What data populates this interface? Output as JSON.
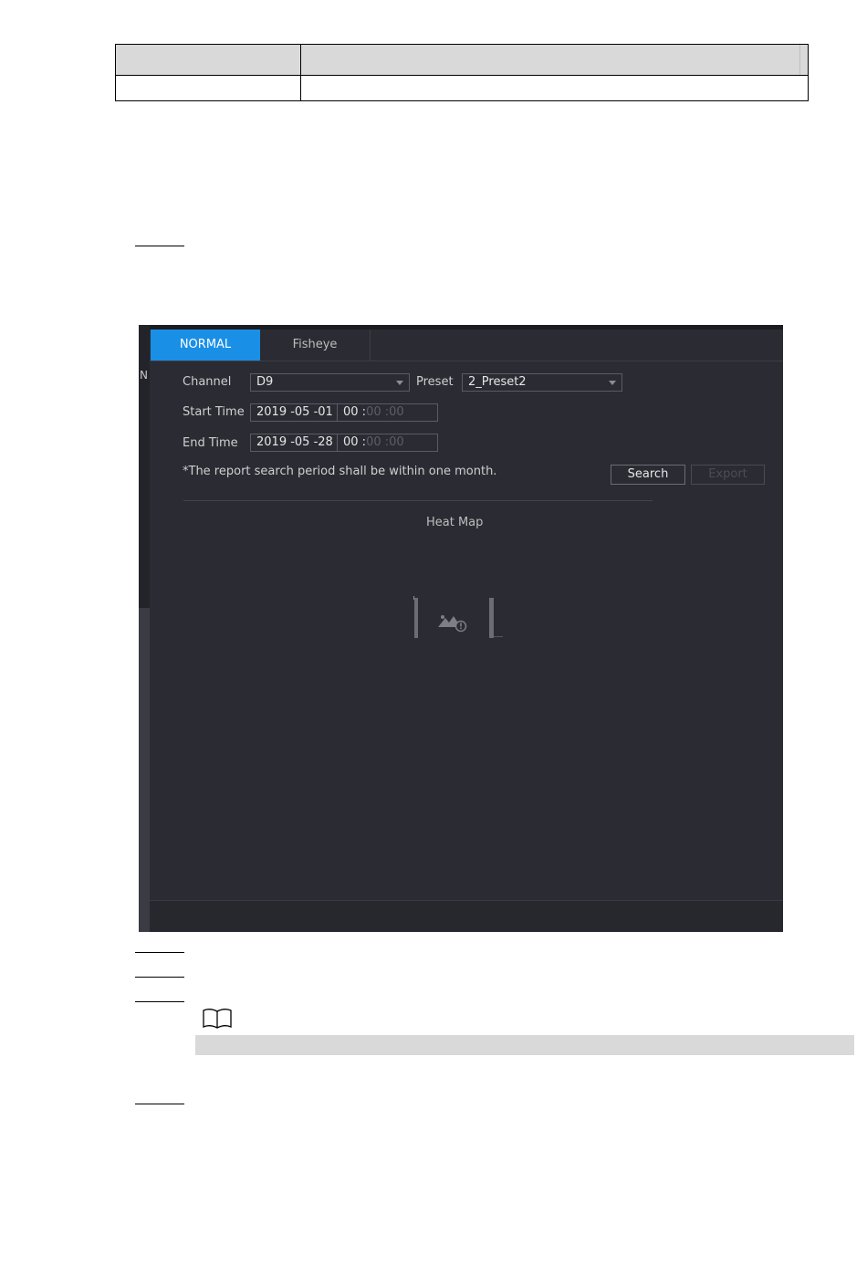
{
  "app": {
    "tabs": [
      {
        "label": "NORMAL",
        "active": true
      },
      {
        "label": "Fisheye",
        "active": false
      }
    ],
    "left_strip_letter": "N",
    "form": {
      "channel_label": "Channel",
      "channel_value": "D9",
      "preset_label": "Preset",
      "preset_value": "2_Preset2",
      "start_time_label": "Start Time",
      "start_date": "2019 -05 -01",
      "start_hour": "00 :",
      "start_min": "00 :",
      "start_sec": "00",
      "end_time_label": "End Time",
      "end_date": "2019 -05 -28",
      "end_hour": "00 :",
      "end_min": "00 :",
      "end_sec": "00",
      "notice": "*The report search period shall be within one month.",
      "search_button": "Search",
      "export_button": "Export"
    },
    "heatmap": {
      "title": "Heat Map",
      "placeholder_icon": "image-missing-icon"
    },
    "colors": {
      "accent": "#1a8fe6",
      "background": "#2b2c33"
    }
  },
  "note_icon": "book-icon"
}
